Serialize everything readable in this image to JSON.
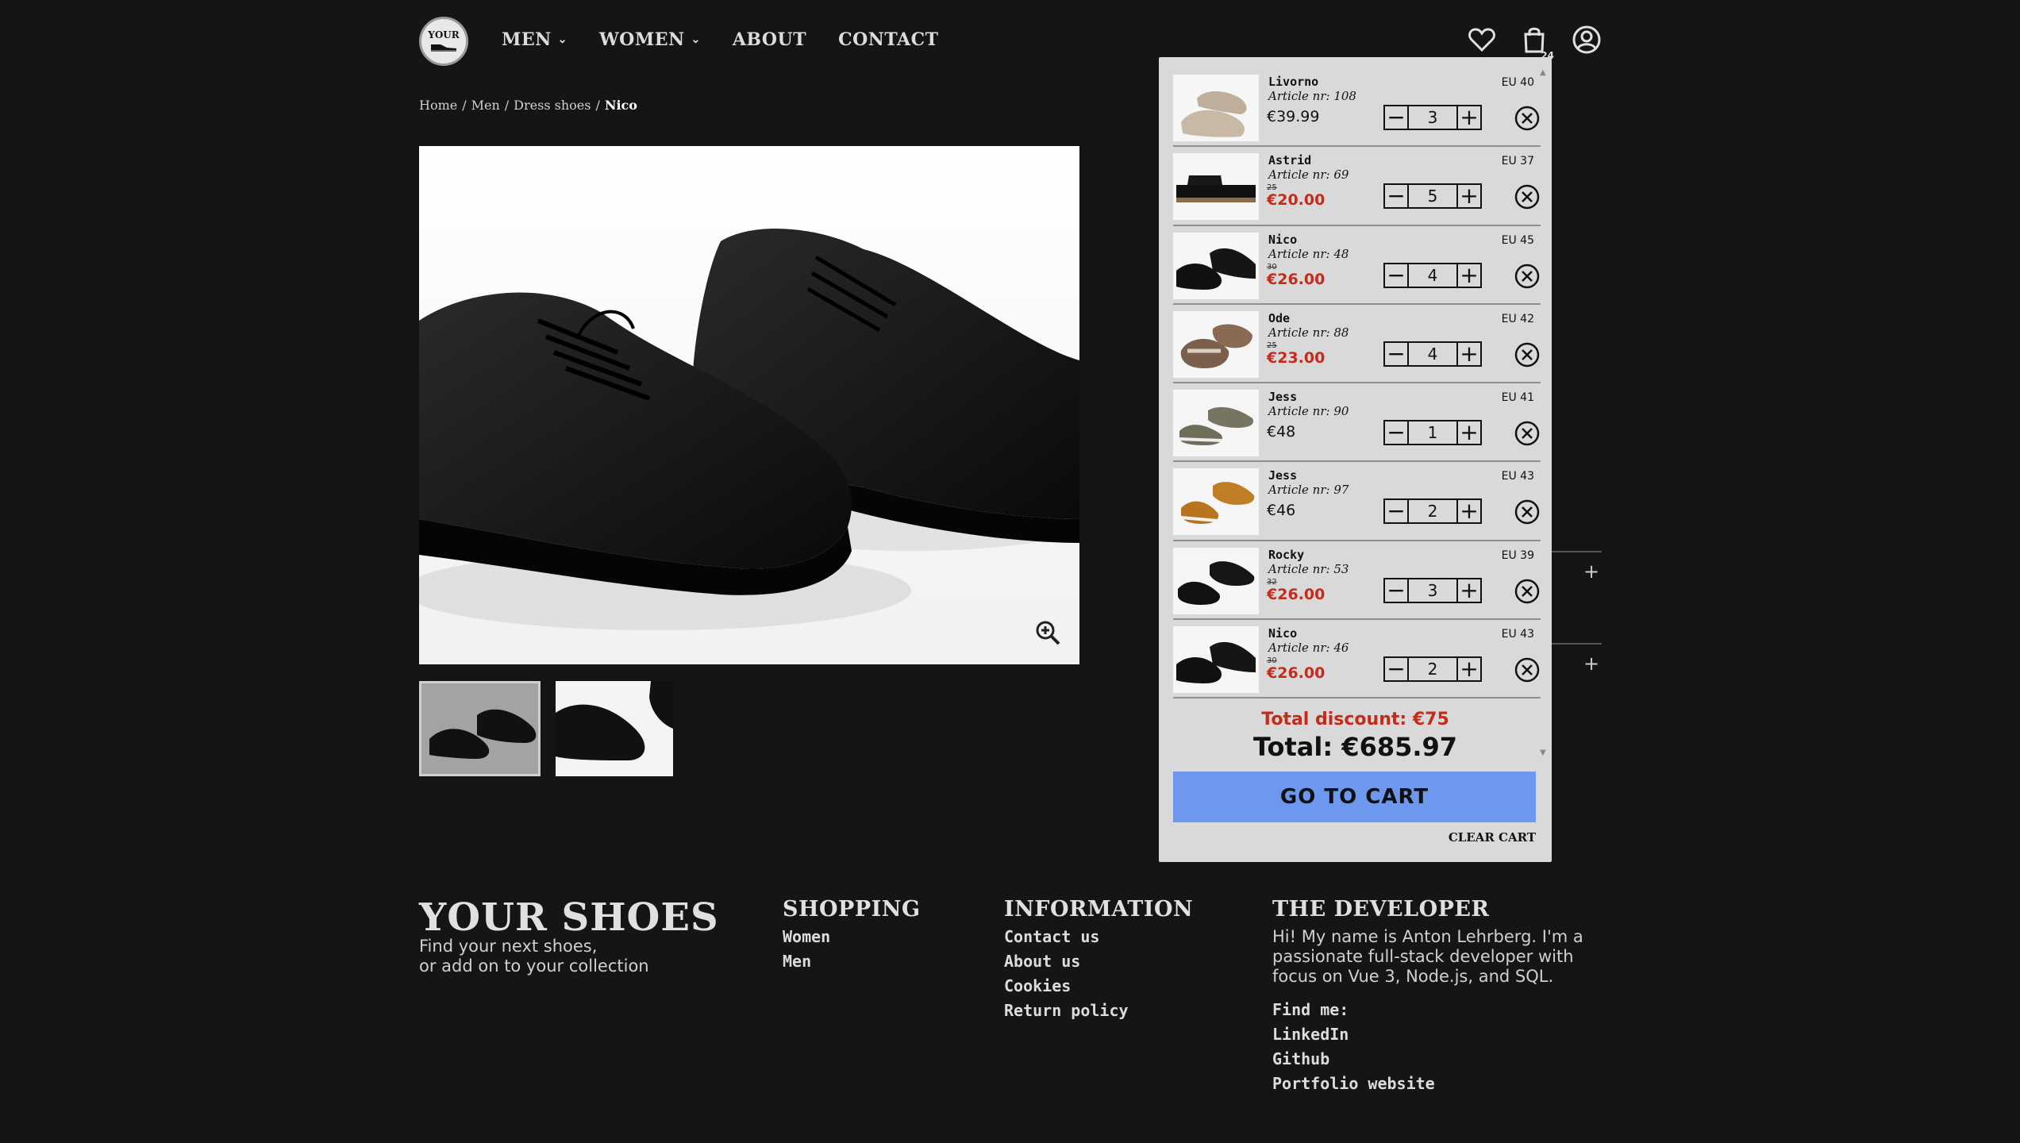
{
  "header": {
    "logo_text": "YOUR",
    "nav": [
      {
        "label": "MEN",
        "dropdown": true
      },
      {
        "label": "WOMEN",
        "dropdown": true
      },
      {
        "label": "ABOUT",
        "dropdown": false
      },
      {
        "label": "CONTACT",
        "dropdown": false
      }
    ],
    "cart_count": "24"
  },
  "breadcrumb": [
    {
      "label": "Home"
    },
    {
      "label": "Men"
    },
    {
      "label": "Dress shoes"
    },
    {
      "label": "Nico",
      "current": true
    }
  ],
  "cart": {
    "items": [
      {
        "name": "Livorno",
        "article": "Article nr: 108",
        "size": "EU 40",
        "old_price": "",
        "price": "€39.99",
        "discounted": false,
        "qty": "3",
        "img": "loafer-beige"
      },
      {
        "name": "Astrid",
        "article": "Article nr: 69",
        "size": "EU 37",
        "old_price": "25",
        "price": "€20.00",
        "discounted": true,
        "qty": "5",
        "img": "sandal-black"
      },
      {
        "name": "Nico",
        "article": "Article nr: 48",
        "size": "EU 45",
        "old_price": "30",
        "price": "€26.00",
        "discounted": true,
        "qty": "4",
        "img": "derby-black"
      },
      {
        "name": "Ode",
        "article": "Article nr: 88",
        "size": "EU 42",
        "old_price": "25",
        "price": "€23.00",
        "discounted": true,
        "qty": "4",
        "img": "slipper-brown"
      },
      {
        "name": "Jess",
        "article": "Article nr: 90",
        "size": "EU 41",
        "old_price": "",
        "price": "€48",
        "discounted": false,
        "qty": "1",
        "img": "sneaker-olive"
      },
      {
        "name": "Jess",
        "article": "Article nr: 97",
        "size": "EU 43",
        "old_price": "",
        "price": "€46",
        "discounted": false,
        "qty": "2",
        "img": "sneaker-tan"
      },
      {
        "name": "Rocky",
        "article": "Article nr: 53",
        "size": "EU 39",
        "old_price": "32",
        "price": "€26.00",
        "discounted": true,
        "qty": "3",
        "img": "sneaker-black"
      },
      {
        "name": "Nico",
        "article": "Article nr: 46",
        "size": "EU 43",
        "old_price": "30",
        "price": "€26.00",
        "discounted": true,
        "qty": "2",
        "img": "derby-black"
      }
    ],
    "total_discount": "Total discount: €75",
    "total": "Total: €685.97",
    "go_to_cart": "GO TO CART",
    "clear_cart": "CLEAR CART"
  },
  "footer": {
    "brand": "YOUR SHOES",
    "tagline_1": "Find your next shoes,",
    "tagline_2": "or add on to your collection",
    "shopping": {
      "title": "SHOPPING",
      "links": [
        "Women",
        "Men"
      ]
    },
    "information": {
      "title": "INFORMATION",
      "links": [
        "Contact us",
        "About us",
        "Cookies",
        "Return policy"
      ]
    },
    "developer": {
      "title": "THE DEVELOPER",
      "text": "Hi! My name is Anton Lehrberg. I'm a passionate full-stack developer with focus on Vue 3, Node.js, and SQL.",
      "find_me": "Find me:",
      "links": [
        "LinkedIn",
        "Github",
        "Portfolio website"
      ]
    }
  },
  "colors": {
    "background": "#131516",
    "cart_bg": "#d9d9d9",
    "accent_button": "#6d98ee",
    "discount_red": "#c62a1a"
  }
}
